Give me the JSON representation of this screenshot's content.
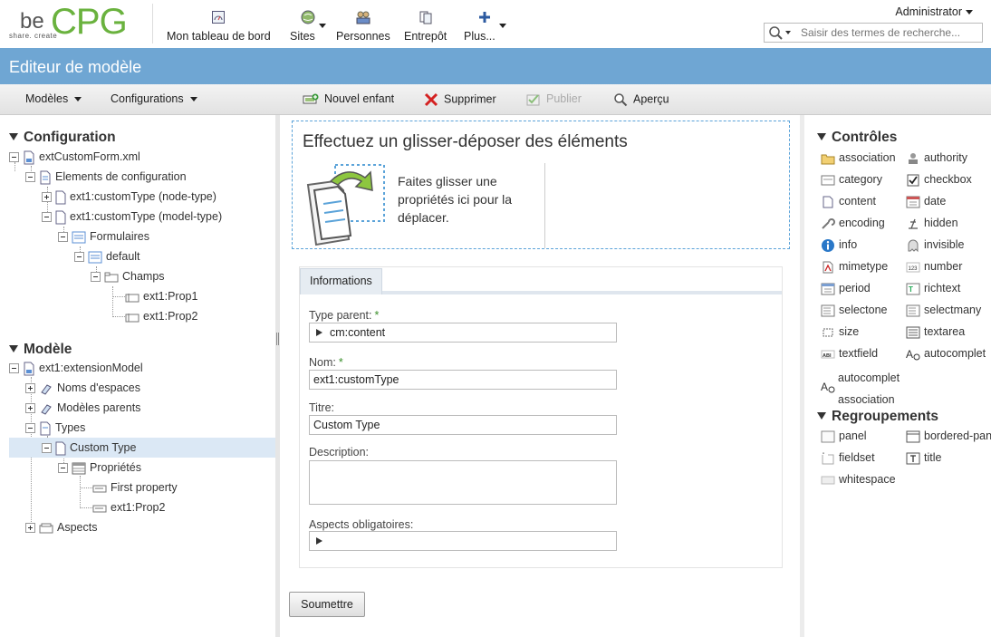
{
  "header": {
    "logo_be": "be",
    "logo_cpg": "CPG",
    "logo_tagline": "share. create",
    "user": "Administrator",
    "search_placeholder": "Saisir des termes de recherche...",
    "nav": [
      {
        "label": "Mon tableau de bord",
        "icon": "dashboard-icon"
      },
      {
        "label": "Sites",
        "icon": "sites-icon"
      },
      {
        "label": "Personnes",
        "icon": "people-icon"
      },
      {
        "label": "Entrepôt",
        "icon": "repository-icon"
      },
      {
        "label": "Plus...",
        "icon": "plus-icon"
      }
    ]
  },
  "page_title": "Editeur de modèle",
  "toolbar": {
    "modeles": "Modèles",
    "configurations": "Configurations",
    "new_child": "Nouvel enfant",
    "delete": "Supprimer",
    "publish": "Publier",
    "preview": "Aperçu"
  },
  "tree": {
    "configuration": {
      "title": "Configuration",
      "nodes": [
        "extCustomForm.xml",
        "Elements de configuration",
        "ext1:customType (node-type)",
        "ext1:customType (model-type)",
        "Formulaires",
        "default",
        "Champs",
        "ext1:Prop1",
        "ext1:Prop2"
      ]
    },
    "modele": {
      "title": "Modèle",
      "nodes": [
        "ext1:extensionModel",
        "Noms d'espaces",
        "Modèles parents",
        "Types",
        "Custom Type",
        "Propriétés",
        "First property",
        "ext1:Prop2",
        "Aspects"
      ]
    }
  },
  "dropzone": {
    "title": "Effectuez un glisser-déposer des éléments",
    "text": "Faites glisser une propriétés ici pour la déplacer."
  },
  "form": {
    "tab": "Informations",
    "type_parent_label": "Type parent:",
    "type_parent_value": "cm:content",
    "nom_label": "Nom:",
    "nom_value": "ext1:customType",
    "titre_label": "Titre:",
    "titre_value": "Custom Type",
    "description_label": "Description:",
    "aspects_label": "Aspects obligatoires:",
    "required_mark": "*",
    "submit": "Soumettre"
  },
  "controls": {
    "title": "Contrôles",
    "items": [
      "association",
      "authority",
      "category",
      "checkbox",
      "content",
      "date",
      "encoding",
      "hidden",
      "info",
      "invisible",
      "mimetype",
      "number",
      "period",
      "richtext",
      "selectone",
      "selectmany",
      "size",
      "textarea",
      "textfield",
      "autocomplet",
      "autocomplet association"
    ]
  },
  "groupings": {
    "title": "Regroupements",
    "items": [
      "panel",
      "bordered-panel",
      "fieldset",
      "title",
      "whitespace"
    ]
  },
  "colors": {
    "accent": "#6fa6d3",
    "brand_green": "#6ab23e",
    "selection": "#dbe8f5"
  }
}
